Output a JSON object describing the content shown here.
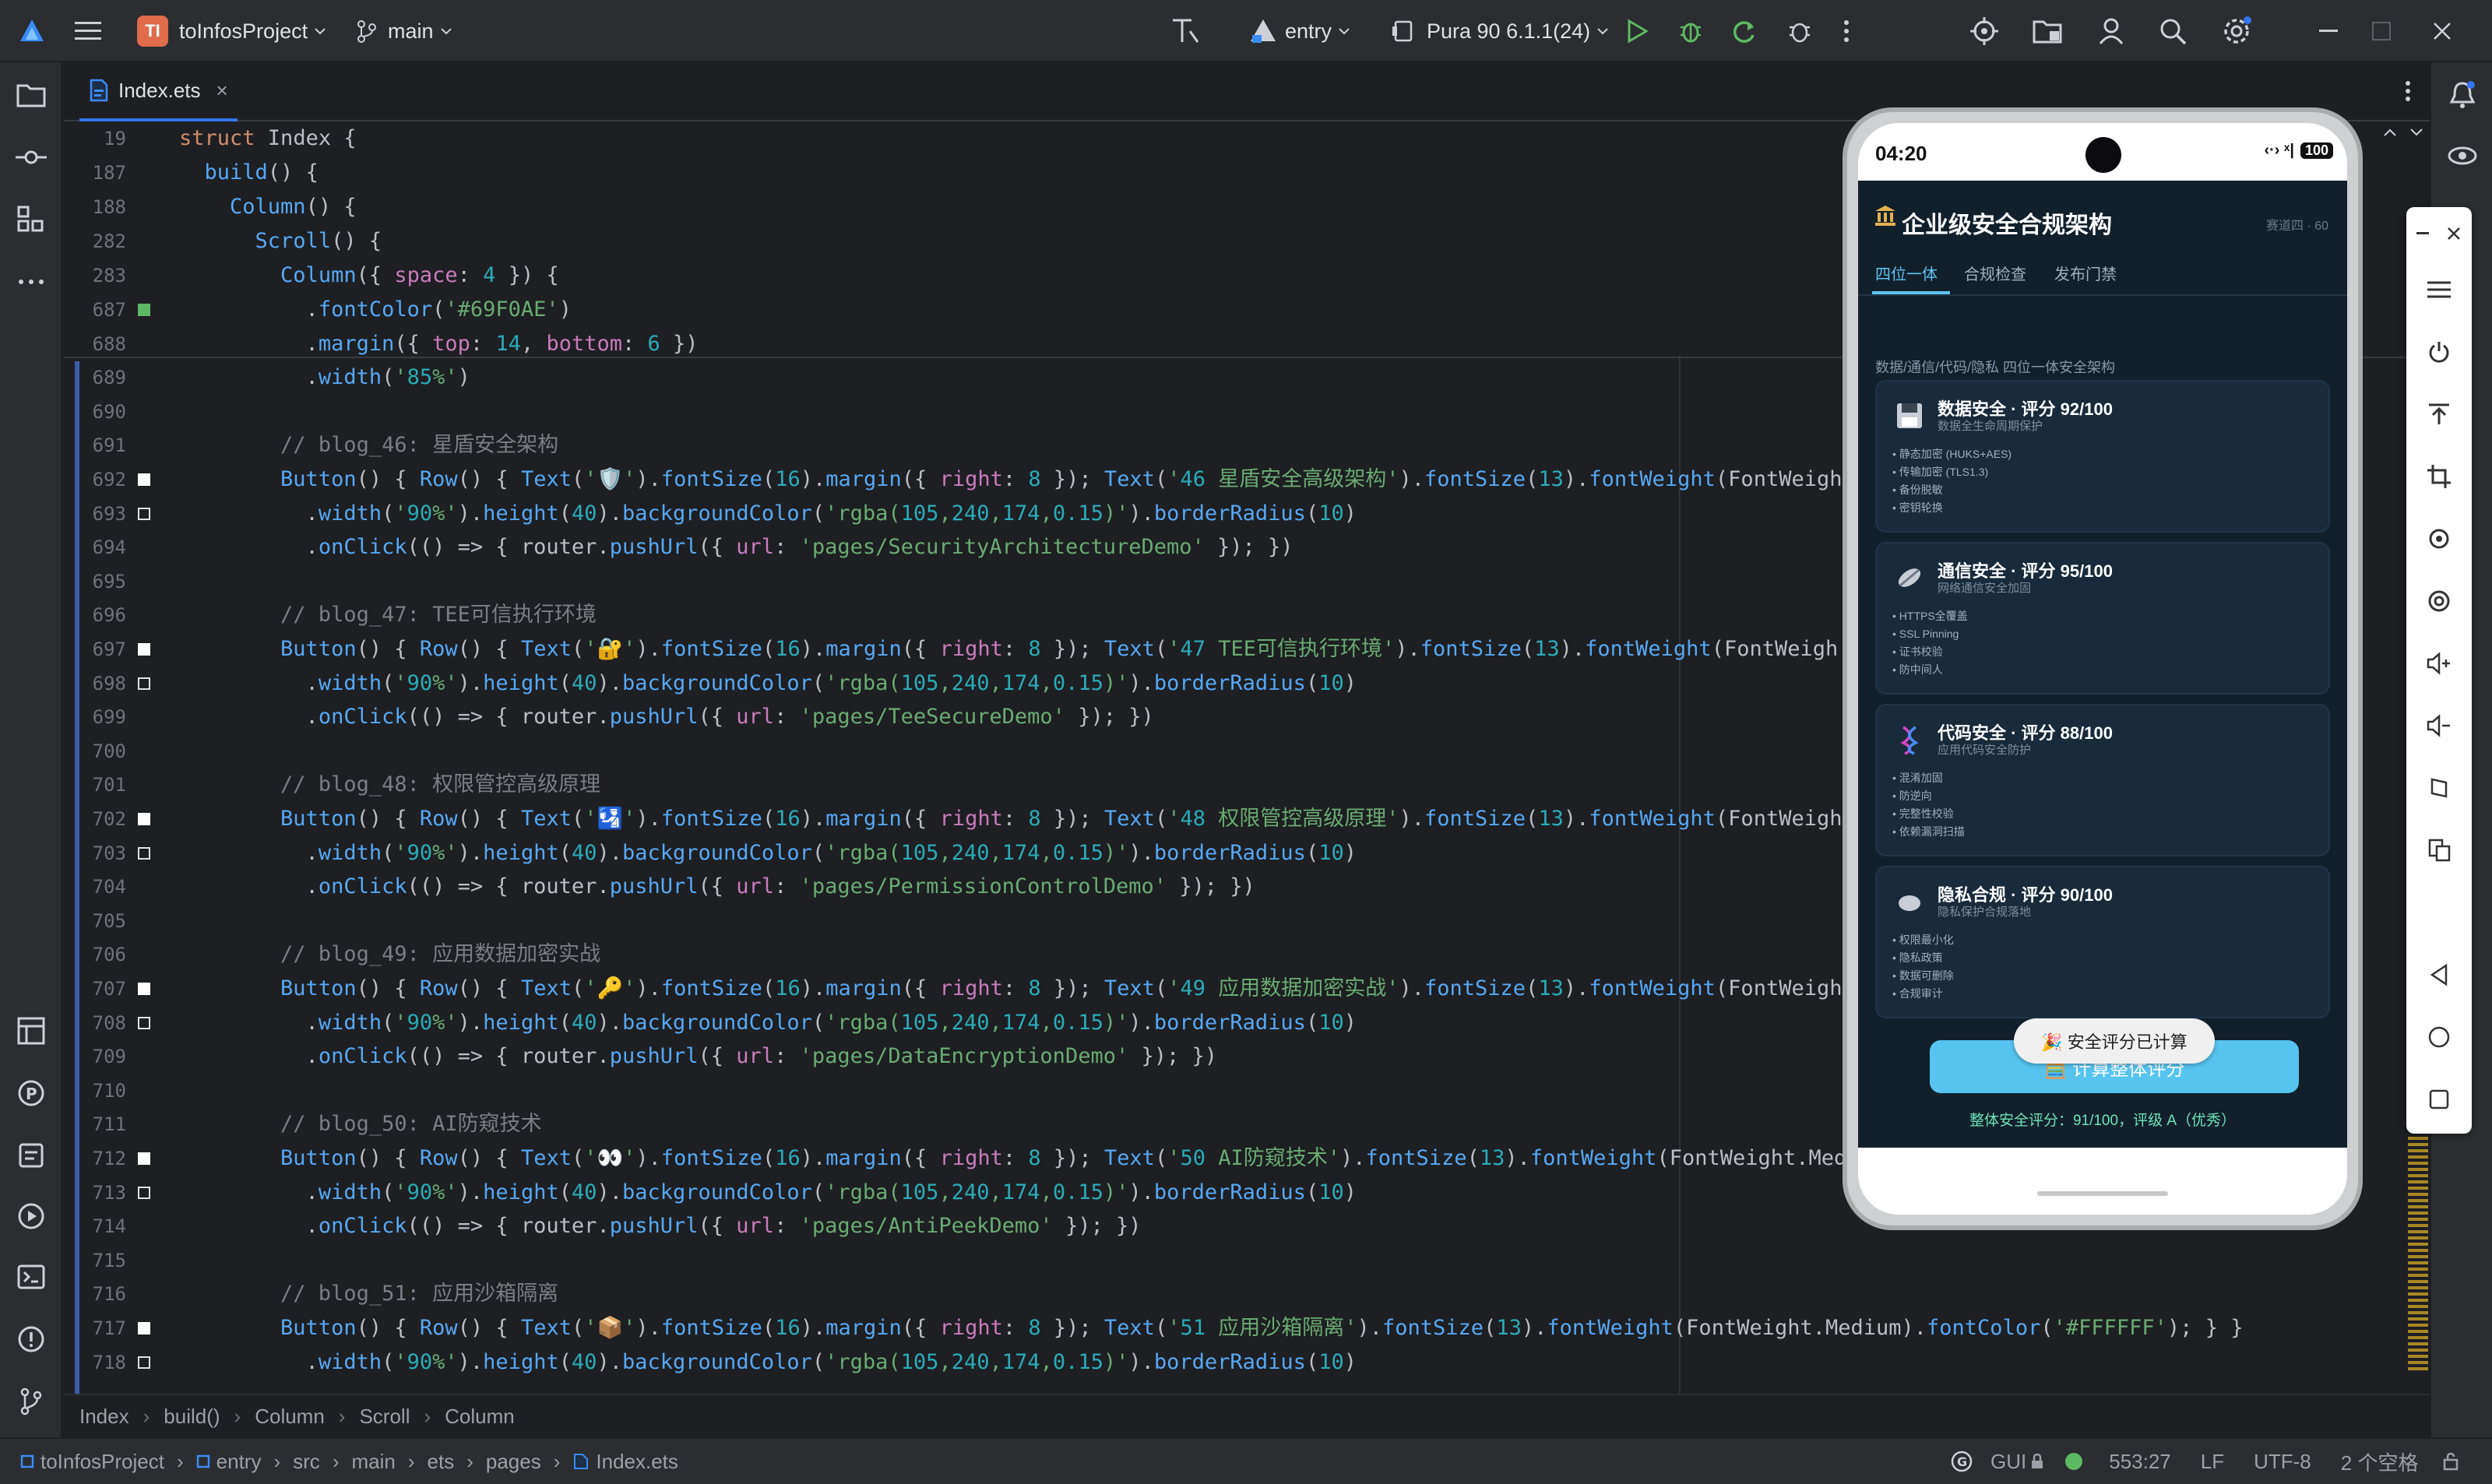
{
  "titlebar": {
    "project": "toInfosProject",
    "project_badge": "TI",
    "branch": "main",
    "run_config": "entry",
    "device": "Pura 90 6.1.1(24)"
  },
  "editor": {
    "tab": "Index.ets",
    "sticky": [
      {
        "num": "19",
        "text": "struct Index {"
      },
      {
        "num": "187",
        "text": "  build() {"
      },
      {
        "num": "188",
        "text": "    Column() {"
      },
      {
        "num": "282",
        "text": "      Scroll() {"
      },
      {
        "num": "283",
        "text": "        Column({ space: 4 }) {"
      }
    ],
    "lines": [
      {
        "num": "687",
        "mark": "green",
        "text": "          .fontColor('#69F0AE')"
      },
      {
        "num": "688",
        "mark": "",
        "text": "          .margin({ top: 14, bottom: 6 })"
      },
      {
        "num": "689",
        "mark": "",
        "text": "          .width('85%')"
      },
      {
        "num": "690",
        "mark": "",
        "text": ""
      },
      {
        "num": "691",
        "mark": "",
        "text": "        // blog_46: 星盾安全架构"
      },
      {
        "num": "692",
        "mark": "filled",
        "text": "        Button() { Row() { Text('🛡️').fontSize(16).margin({ right: 8 }); Text('46 星盾安全高级架构').fontSize(13).fontWeight(FontWeigh"
      },
      {
        "num": "693",
        "mark": "hollow",
        "text": "          .width('90%').height(40).backgroundColor('rgba(105,240,174,0.15)').borderRadius(10)"
      },
      {
        "num": "694",
        "mark": "",
        "text": "          .onClick(() => { router.pushUrl({ url: 'pages/SecurityArchitectureDemo' }); })"
      },
      {
        "num": "695",
        "mark": "",
        "text": ""
      },
      {
        "num": "696",
        "mark": "",
        "text": "        // blog_47: TEE可信执行环境"
      },
      {
        "num": "697",
        "mark": "filled",
        "text": "        Button() { Row() { Text('🔐').fontSize(16).margin({ right: 8 }); Text('47 TEE可信执行环境').fontSize(13).fontWeight(FontWeigh"
      },
      {
        "num": "698",
        "mark": "hollow",
        "text": "          .width('90%').height(40).backgroundColor('rgba(105,240,174,0.15)').borderRadius(10)"
      },
      {
        "num": "699",
        "mark": "",
        "text": "          .onClick(() => { router.pushUrl({ url: 'pages/TeeSecureDemo' }); })"
      },
      {
        "num": "700",
        "mark": "",
        "text": ""
      },
      {
        "num": "701",
        "mark": "",
        "text": "        // blog_48: 权限管控高级原理"
      },
      {
        "num": "702",
        "mark": "filled",
        "text": "        Button() { Row() { Text('🛂').fontSize(16).margin({ right: 8 }); Text('48 权限管控高级原理').fontSize(13).fontWeight(FontWeigh"
      },
      {
        "num": "703",
        "mark": "hollow",
        "text": "          .width('90%').height(40).backgroundColor('rgba(105,240,174,0.15)').borderRadius(10)"
      },
      {
        "num": "704",
        "mark": "",
        "text": "          .onClick(() => { router.pushUrl({ url: 'pages/PermissionControlDemo' }); })"
      },
      {
        "num": "705",
        "mark": "",
        "text": ""
      },
      {
        "num": "706",
        "mark": "",
        "text": "        // blog_49: 应用数据加密实战"
      },
      {
        "num": "707",
        "mark": "filled",
        "text": "        Button() { Row() { Text('🔑').fontSize(16).margin({ right: 8 }); Text('49 应用数据加密实战').fontSize(13).fontWeight(FontWeigh"
      },
      {
        "num": "708",
        "mark": "hollow",
        "text": "          .width('90%').height(40).backgroundColor('rgba(105,240,174,0.15)').borderRadius(10)"
      },
      {
        "num": "709",
        "mark": "",
        "text": "          .onClick(() => { router.pushUrl({ url: 'pages/DataEncryptionDemo' }); })"
      },
      {
        "num": "710",
        "mark": "",
        "text": ""
      },
      {
        "num": "711",
        "mark": "",
        "text": "        // blog_50: AI防窥技术"
      },
      {
        "num": "712",
        "mark": "filled",
        "text": "        Button() { Row() { Text('👀').fontSize(16).margin({ right: 8 }); Text('50 AI防窥技术').fontSize(13).fontWeight(FontWeight.Med"
      },
      {
        "num": "713",
        "mark": "hollow",
        "text": "          .width('90%').height(40).backgroundColor('rgba(105,240,174,0.15)').borderRadius(10)"
      },
      {
        "num": "714",
        "mark": "",
        "text": "          .onClick(() => { router.pushUrl({ url: 'pages/AntiPeekDemo' }); })"
      },
      {
        "num": "715",
        "mark": "",
        "text": ""
      },
      {
        "num": "716",
        "mark": "",
        "text": "        // blog_51: 应用沙箱隔离"
      },
      {
        "num": "717",
        "mark": "filled",
        "text": "        Button() { Row() { Text('📦').fontSize(16).margin({ right: 8 }); Text('51 应用沙箱隔离').fontSize(13).fontWeight(FontWeight.Medium).fontColor('#FFFFFF'); } }"
      },
      {
        "num": "718",
        "mark": "hollow",
        "text": "          .width('90%').height(40).backgroundColor('rgba(105,240,174,0.15)').borderRadius(10)"
      }
    ]
  },
  "breadcrumb": [
    "Index",
    "build()",
    "Column",
    "Scroll",
    "Column"
  ],
  "statusbar": {
    "path": [
      "toInfosProject",
      "entry",
      "src",
      "main",
      "ets",
      "pages",
      "Index.ets"
    ],
    "gui": "GUI",
    "position": "553:27",
    "line_sep": "LF",
    "encoding": "UTF-8",
    "indent": "2 个空格"
  },
  "phone": {
    "time": "04:20",
    "battery": "100",
    "app_title": "企业级安全合规架构",
    "app_subtitle": "赛道四 · 60",
    "tabs": [
      "四位一体",
      "合规检查",
      "发布门禁"
    ],
    "section_label": "数据/通信/代码/隐私 四位一体安全架构",
    "cards": [
      {
        "title": "数据安全 · 评分 92/100",
        "sub": "数据全生命周期保护",
        "items": [
          "静态加密 (HUKS+AES)",
          "传输加密 (TLS1.3)",
          "备份脱敏",
          "密钥轮换"
        ]
      },
      {
        "title": "通信安全 · 评分 95/100",
        "sub": "网络通信安全加固",
        "items": [
          "HTTPS全覆盖",
          "SSL Pinning",
          "证书校验",
          "防中间人"
        ]
      },
      {
        "title": "代码安全 · 评分 88/100",
        "sub": "应用代码安全防护",
        "items": [
          "混淆加固",
          "防逆向",
          "完整性校验",
          "依赖漏洞扫描"
        ]
      },
      {
        "title": "隐私合规 · 评分 90/100",
        "sub": "隐私保护合规落地",
        "items": [
          "权限最小化",
          "隐私政策",
          "数据可删除",
          "合规审计"
        ]
      }
    ],
    "toast": "🎉 安全评分已计算",
    "calc_button": "🧮 计算整体评分",
    "result": "整体安全评分：91/100，评级 A（优秀）"
  },
  "colors": {
    "accent": "#3574f0",
    "phone_bg": "#12202c",
    "phone_accent": "#56c4ee",
    "result_green": "#6ee3b4",
    "run_green": "#5fb865"
  }
}
